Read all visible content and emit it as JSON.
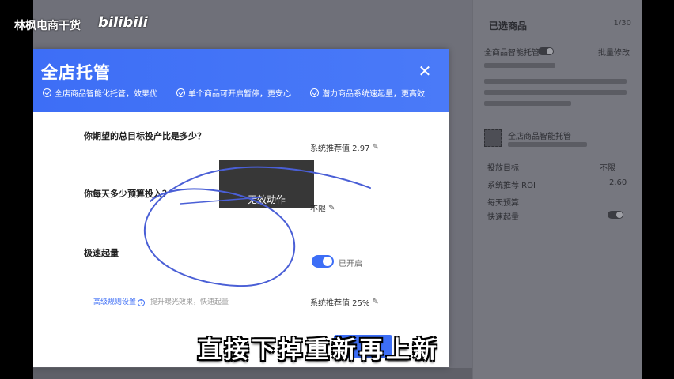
{
  "watermark": {
    "channel": "林枫电商干货",
    "logo": "bilibili"
  },
  "background": {
    "panel_title": "已选商品",
    "panel_count": "1/30",
    "row1_label": "全商品智能托管",
    "row1_action": "批量修改",
    "item_title": "全店商品智能托管",
    "label_a": "投放目标",
    "value_a": "不限",
    "label_b": "系统推荐 ROI",
    "value_b": "2.60",
    "label_c": "每天预算",
    "label_d": "快速起量"
  },
  "modal": {
    "title": "全店托管",
    "close_symbol": "✕",
    "features": [
      "全店商品智能化托管，效果优",
      "单个商品可开启暂停，更安心",
      "潜力商品系统速起量，更高效"
    ],
    "q1": "你期望的总目标投产比是多少？",
    "q1_value": "系统推荐值 2.97",
    "q2": "你每天多少预算投入？",
    "q2_value": "不限",
    "q3": "极速起量",
    "q3_toggle_label": "已开启",
    "q3_link": "高级规则设置",
    "q3_link_desc": "提升曝光效果，快速起量",
    "q3_rate": "系统推荐值 25%",
    "pencil_symbol": "✎",
    "help_symbol": "?"
  },
  "toast": {
    "text": "无效动作"
  },
  "subtitle": "直接下掉重新再上新",
  "colors": {
    "accent": "#3d6ef6",
    "scribble": "#4a5fd6"
  }
}
